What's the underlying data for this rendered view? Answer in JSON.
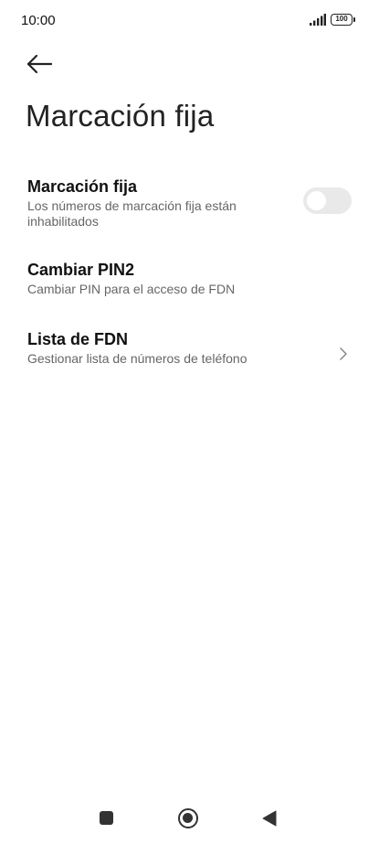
{
  "status_bar": {
    "time": "10:00",
    "battery": "100",
    "icons": [
      "signal-icon",
      "battery-icon"
    ]
  },
  "header": {
    "back_icon": "back-arrow-icon",
    "title": "Marcación fija"
  },
  "settings": {
    "fixed_dialing": {
      "title": "Marcación fija",
      "subtitle_line1": "Los números de marcación fija están",
      "subtitle_line2": "inhabilitados",
      "toggle_on": false
    },
    "change_pin2": {
      "title": "Cambiar PIN2",
      "subtitle": "Cambiar PIN para el acceso de FDN"
    },
    "fdn_list": {
      "title": "Lista de FDN",
      "subtitle": "Gestionar lista de números de teléfono",
      "icon": "chevron-right-icon"
    }
  },
  "nav_bar": {
    "icons": [
      "recents-icon",
      "home-icon",
      "back-triangle-icon"
    ]
  },
  "colors": {
    "background": "#ffffff",
    "title_text": "#111111",
    "subtitle_text": "#666666",
    "toggle_off": "#e9e9e9",
    "nav_icons": "#333333"
  }
}
